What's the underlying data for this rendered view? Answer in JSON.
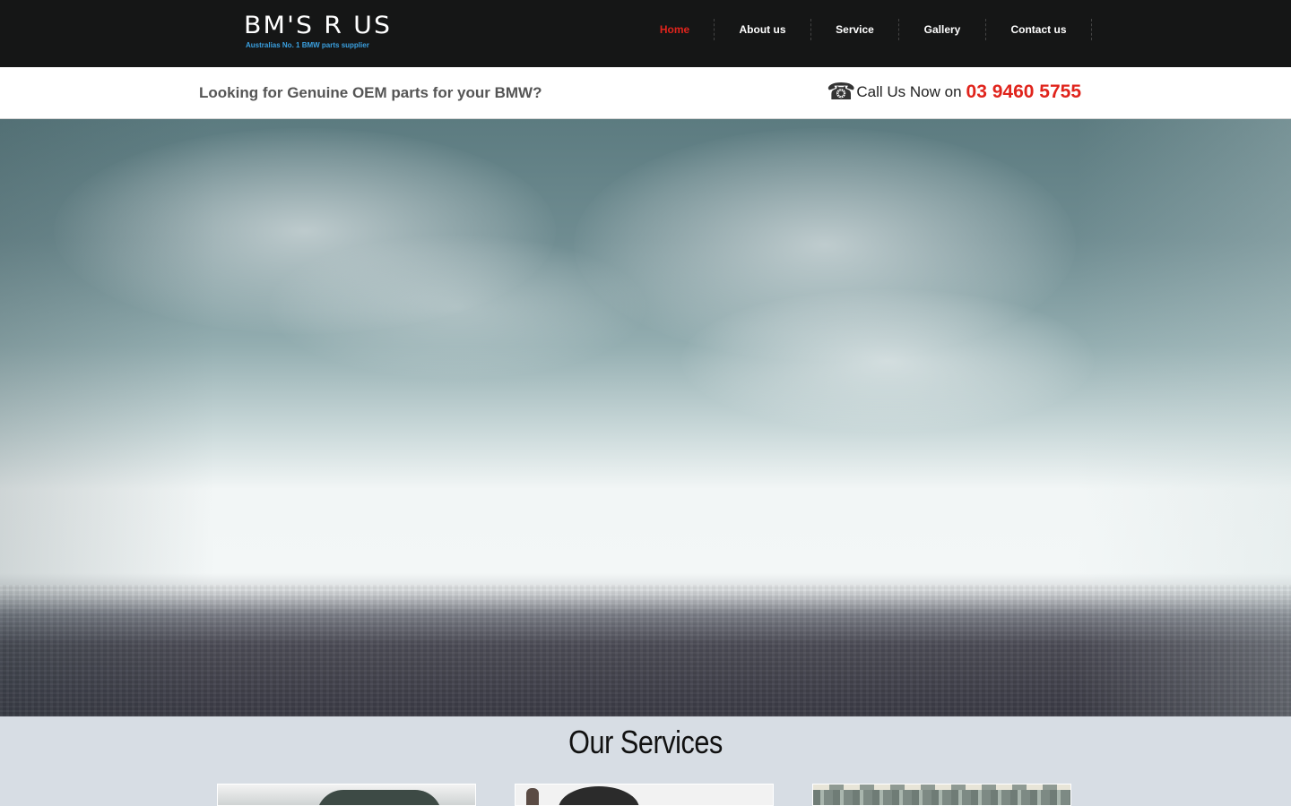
{
  "header": {
    "logo_title": "BM'S R US",
    "logo_tagline": "Australias No. 1 BMW parts supplier",
    "nav": [
      {
        "label": "Home",
        "active": true
      },
      {
        "label": "About us",
        "active": false
      },
      {
        "label": "Service",
        "active": false
      },
      {
        "label": "Gallery",
        "active": false
      },
      {
        "label": "Contact us",
        "active": false
      }
    ]
  },
  "subbar": {
    "tagline": "Looking for Genuine OEM parts for your BMW?",
    "call_text": "Call Us Now on",
    "phone_number": "03 9460 5755",
    "phone_icon": "telephone-icon"
  },
  "services": {
    "title": "Our Services"
  },
  "colors": {
    "header_bg": "#151616",
    "accent_red": "#e0241c",
    "tagline_blue": "#3aa0e0",
    "services_bg": "#d7dde4"
  }
}
